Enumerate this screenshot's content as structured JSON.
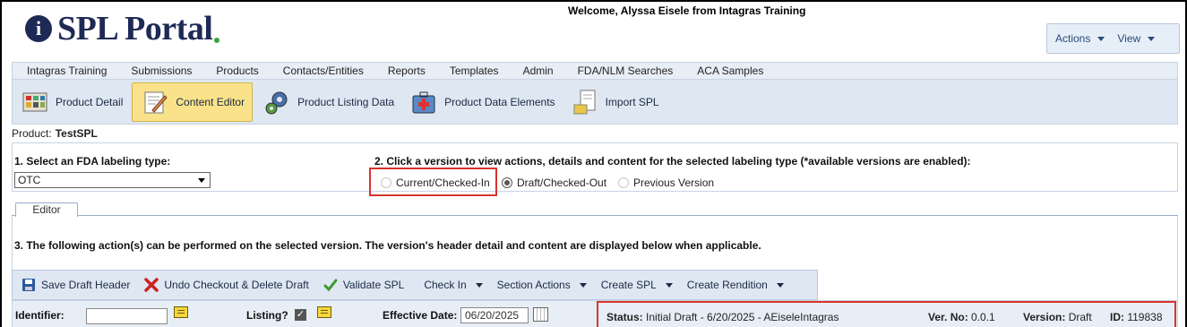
{
  "header": {
    "logo_text": "SPL Portal",
    "logo_icon": "info-icon",
    "welcome": "Welcome, Alyssa Eisele from Intagras Training",
    "actions_label": "Actions",
    "view_label": "View"
  },
  "menu": [
    "Intagras Training",
    "Submissions",
    "Products",
    "Contacts/Entities",
    "Reports",
    "Templates",
    "Admin",
    "FDA/NLM Searches",
    "ACA Samples"
  ],
  "toolbar": [
    {
      "label": "Product Detail",
      "icon": "product-detail-icon"
    },
    {
      "label": "Content Editor",
      "icon": "content-editor-icon",
      "active": true
    },
    {
      "label": "Product Listing Data",
      "icon": "gears-icon"
    },
    {
      "label": "Product Data Elements",
      "icon": "medical-kit-icon"
    },
    {
      "label": "Import SPL",
      "icon": "import-document-icon"
    }
  ],
  "product": {
    "label": "Product:",
    "name": "TestSPL"
  },
  "step1": {
    "label": "1. Select an FDA labeling type:",
    "selected": "OTC"
  },
  "step2": {
    "label": "2. Click a version to view actions, details and content for the selected labeling type (*available versions are enabled):",
    "options": [
      "Current/Checked-In",
      "Draft/Checked-Out",
      "Previous Version"
    ],
    "checked": "Draft/Checked-Out"
  },
  "tab": {
    "label": "Editor"
  },
  "step3": {
    "label": "3. The following action(s) can be performed on the selected version. The version's header detail and content are displayed below when applicable."
  },
  "actions": {
    "save": "Save Draft Header",
    "undo": "Undo Checkout & Delete Draft",
    "validate": "Validate SPL",
    "checkin": "Check In",
    "section": "Section Actions",
    "create_spl": "Create SPL",
    "create_rendition": "Create Rendition"
  },
  "fields": {
    "identifier_label": "Identifier:",
    "identifier_value": "",
    "listing_label": "Listing?",
    "effective_label": "Effective Date:",
    "effective_value": "06/20/2025"
  },
  "status": {
    "status_label": "Status:",
    "status_value": "Initial Draft - 6/20/2025 - AEiseleIntagras",
    "verno_label": "Ver. No:",
    "verno_value": "0.0.1",
    "version_label": "Version:",
    "version_value": "Draft",
    "id_label": "ID:",
    "id_value": "119838"
  },
  "colors": {
    "brand": "#1e2a55",
    "highlight_box": "#d9342b",
    "active_tab": "#f9e28a"
  }
}
